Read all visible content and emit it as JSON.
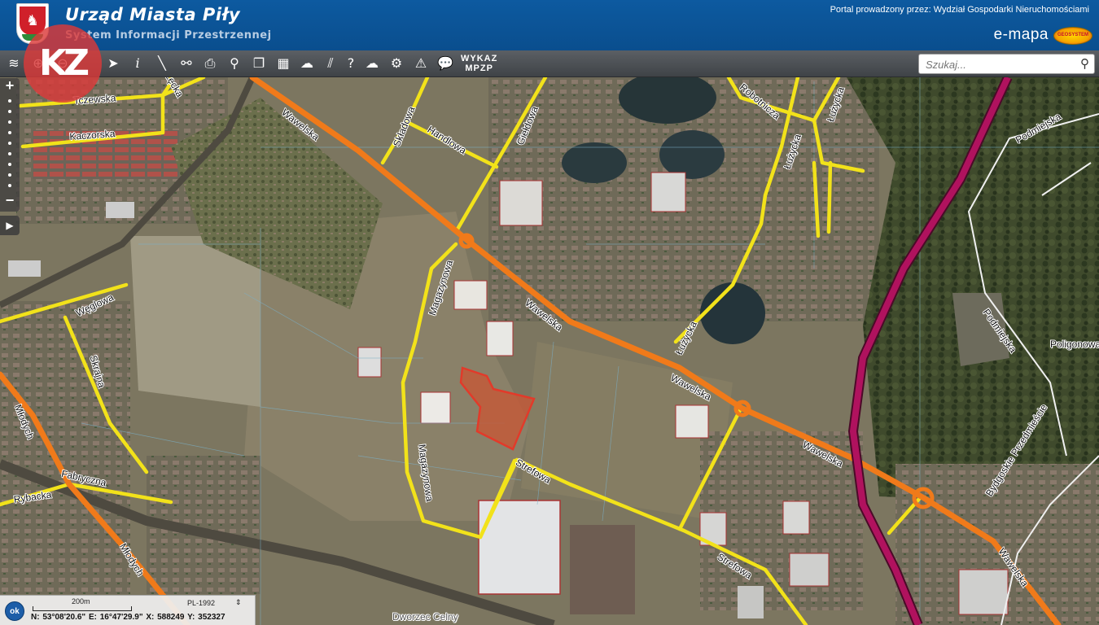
{
  "header": {
    "title": "Urząd Miasta Piły",
    "subtitle": "System Informacji Przestrzennej",
    "portal_text": "Portal prowadzony przez: Wydział Gospodarki Nieruchomościami",
    "brand": "e-mapa",
    "brand_badge": "GEOSYSTEM"
  },
  "toolbar": {
    "tools": [
      "layers-icon",
      "zoom-in-icon",
      "zoom-out-icon",
      "pointer-icon",
      "info-icon",
      "measure-icon",
      "link-icon",
      "print-icon",
      "locate-icon",
      "copy-icon",
      "layout-icon",
      "shape-icon",
      "hatch-icon",
      "help-icon",
      "cloud-icon",
      "settings-icon",
      "warning-icon",
      "comment-icon"
    ],
    "wykaz_line1": "WYKAZ",
    "wykaz_line2": "MPZP"
  },
  "search": {
    "placeholder": "Szukaj..."
  },
  "watermark": "KZ",
  "streets": {
    "wawelska_1": "Wawelska",
    "wawelska_2": "Wawelska",
    "wawelska_3": "Wawelska",
    "wawelska_4": "Wawelska",
    "wawelska_5": "Wawelska",
    "tczewska": "Tczewska",
    "kaczorska": "Kaczorska",
    "chelmska": "Łęcka",
    "skladowa": "Składowa",
    "handlowa": "Handlowa",
    "gieldowa": "Giełdowa",
    "robotnicza": "Robotnicza",
    "lutycka_top": "Łużycka",
    "lutycka_mid": "Łużycka",
    "lutycka_low": "Łużycka",
    "weglowa": "Węglowa",
    "magazynowa_1": "Magazynowa",
    "magazynowa_2": "Magazynowa",
    "skrajna": "Skrajna",
    "mlodych_1": "Młodych",
    "mlodych_2": "Młodych",
    "fabryczna": "Fabryczna",
    "rybacka": "Rybacka",
    "strefowa_1": "Strefowa",
    "strefowa_2": "Strefowa",
    "podmiejska_1": "Podmiejska",
    "podmiejska_2": "Podmiejska",
    "poligonowa": "Poligonowa",
    "bydgoskie": "Bydgoskie Przedmieście",
    "dworzec": "Dworzec Celny"
  },
  "colors": {
    "main_road": "#f07a1a",
    "local_road": "#f2e21a",
    "expressway": "#b0125e",
    "parcel": "#e23a2a",
    "header": "#0d5aa0"
  },
  "scale": {
    "label": "200m",
    "crs": "PL-1992"
  },
  "coordinates": {
    "n": "N: 53°08'20.6\"",
    "e": "E: 16°47'29.9\"",
    "x": "X: 588249",
    "y": "Y: 352327"
  },
  "ok_label": "ok"
}
